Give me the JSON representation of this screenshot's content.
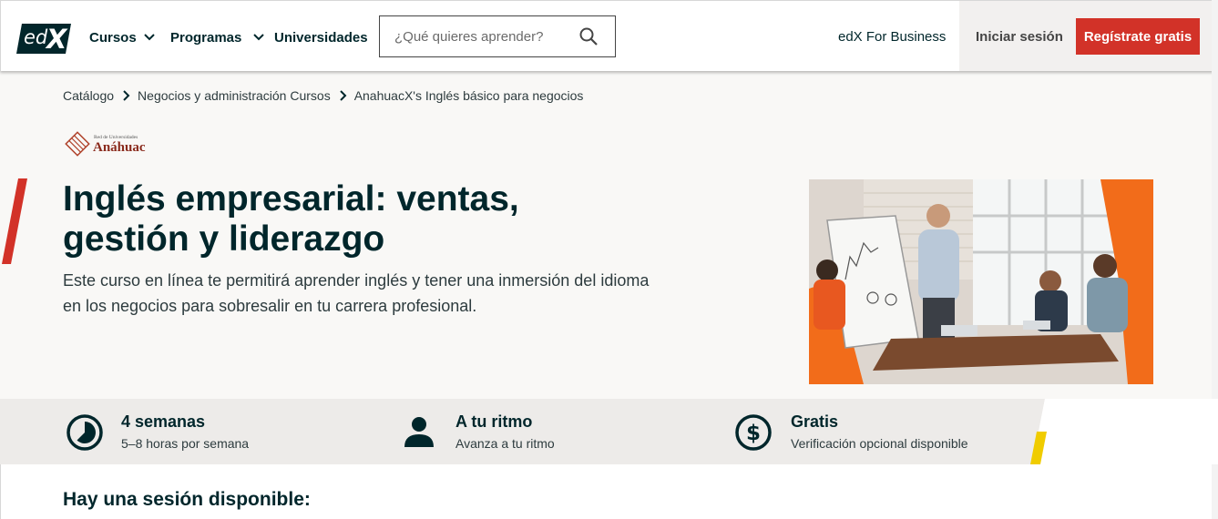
{
  "header": {
    "logo_text": "edX",
    "nav": [
      {
        "label": "Cursos",
        "has_dropdown": true
      },
      {
        "label": "Programas",
        "has_dropdown": true
      },
      {
        "label": "Universidades",
        "has_dropdown": false
      }
    ],
    "search": {
      "placeholder": "¿Qué quieres aprender?",
      "icon": "search-icon"
    },
    "business_label": "edX For Business",
    "login_label": "Iniciar sesión",
    "register_label": "Regístrate gratis",
    "colors": {
      "accent": "#d23228",
      "text": "#00262b"
    }
  },
  "breadcrumb": [
    "Catálogo",
    "Negocios y administración Cursos",
    "AnahuacX's Inglés básico para negocios"
  ],
  "partner": {
    "small_text": "Red de Universidades",
    "name": "Anáhuac"
  },
  "course": {
    "title_line1": "Inglés empresarial: ventas,",
    "title_line2": "gestión y liderazgo",
    "description": "Este curso en línea te permitirá aprender inglés y tener una inmersión del idioma en los negocios para sobresalir en tu carrera profesional.",
    "image_alt": "business meeting presentation photo"
  },
  "features": [
    {
      "icon": "clock-icon",
      "title": "4 semanas",
      "subtitle": "5–8 horas por semana"
    },
    {
      "icon": "person-icon",
      "title": "A tu ritmo",
      "subtitle": "Avanza a tu ritmo"
    },
    {
      "icon": "dollar-icon",
      "title": "Gratis",
      "subtitle": "Verificación opcional disponible"
    }
  ],
  "session_heading": "Hay una sesión disponible:"
}
